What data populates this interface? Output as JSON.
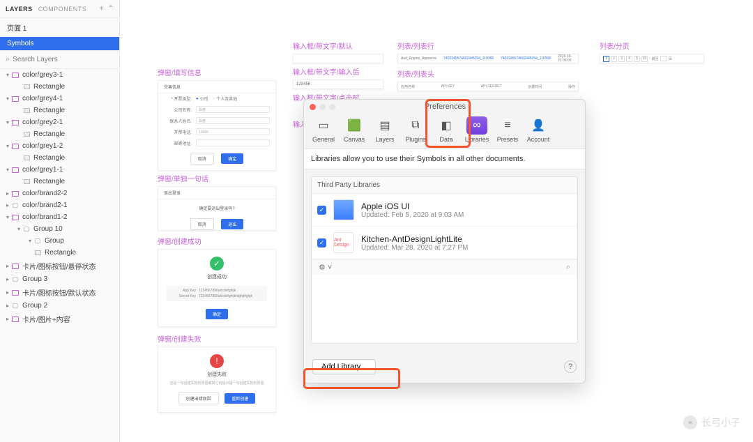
{
  "sidebar": {
    "tabs": {
      "layers": "LAYERS",
      "components": "COMPONENTS"
    },
    "page_label": "页面 1",
    "symbols_label": "Symbols",
    "search_placeholder": "Search Layers"
  },
  "layers": [
    {
      "depth": 1,
      "arrow": "▾",
      "icon": "artboard",
      "label": "color/grey3-1"
    },
    {
      "depth": 2,
      "arrow": "",
      "icon": "rect",
      "label": "Rectangle"
    },
    {
      "depth": 1,
      "arrow": "▾",
      "icon": "artboard",
      "label": "color/grey4-1"
    },
    {
      "depth": 2,
      "arrow": "",
      "icon": "rect",
      "label": "Rectangle"
    },
    {
      "depth": 1,
      "arrow": "▾",
      "icon": "artboard",
      "label": "color/grey2-1"
    },
    {
      "depth": 2,
      "arrow": "",
      "icon": "rect",
      "label": "Rectangle"
    },
    {
      "depth": 1,
      "arrow": "▾",
      "icon": "artboard",
      "label": "color/grey1-2"
    },
    {
      "depth": 2,
      "arrow": "",
      "icon": "rect",
      "label": "Rectangle"
    },
    {
      "depth": 1,
      "arrow": "▾",
      "icon": "artboard",
      "label": "color/grey1-1"
    },
    {
      "depth": 2,
      "arrow": "",
      "icon": "rect",
      "label": "Rectangle"
    },
    {
      "depth": 1,
      "arrow": "▸",
      "icon": "artboard",
      "label": "color/brand2-2"
    },
    {
      "depth": 1,
      "arrow": "▸",
      "icon": "folder",
      "label": "color/brand2-1"
    },
    {
      "depth": 1,
      "arrow": "▾",
      "icon": "artboard",
      "label": "color/brand1-2"
    },
    {
      "depth": 2,
      "arrow": "▾",
      "icon": "folder",
      "label": "Group 10"
    },
    {
      "depth": 3,
      "arrow": "▾",
      "icon": "folder",
      "label": "Group"
    },
    {
      "depth": 3,
      "arrow": "",
      "icon": "rect",
      "label": "Rectangle"
    },
    {
      "depth": 1,
      "arrow": "▸",
      "icon": "artboard",
      "label": "卡片/图标按钮/悬停状态"
    },
    {
      "depth": 1,
      "arrow": "▸",
      "icon": "folder",
      "label": "Group 3"
    },
    {
      "depth": 1,
      "arrow": "▸",
      "icon": "artboard",
      "label": "卡片/图标按钮/默认状态"
    },
    {
      "depth": 1,
      "arrow": "▸",
      "icon": "folder",
      "label": "Group 2"
    },
    {
      "depth": 1,
      "arrow": "▸",
      "icon": "artboard",
      "label": "卡片/图片+内容"
    }
  ],
  "artboards": {
    "fillInfo": {
      "title": "弹窗/填写信息",
      "header": "完善信息",
      "typeLabel": "* 开票类型:",
      "opt1": "公司",
      "opt2": "个人及其他",
      "rows": [
        {
          "lab": "公司名称:",
          "ph": "百度"
        },
        {
          "lab": "联系人姓名:",
          "ph": "百度"
        },
        {
          "lab": "开票电话:",
          "ph": "13666"
        },
        {
          "lab": "邮寄地址:",
          "ph": ""
        }
      ],
      "cancel": "取消",
      "confirm": "确定"
    },
    "singleSentence": {
      "title": "弹窗/单独一句话",
      "header": "退出登录",
      "text": "确定要退出登录吗?",
      "cancel": "取消",
      "confirm": "退出"
    },
    "createSuccess": {
      "title": "弹窗/创建成功",
      "text": "创建成功",
      "kv1l": "App Key",
      "kv1v": "1234567890abcdefghijk",
      "kv2l": "Secret Key",
      "kv2v": "1234567890abcdefghijkhfghjkfghjk",
      "btn": "确定"
    },
    "createFail": {
      "title": "弹窗/创建失败",
      "text": "创建失败",
      "desc": "这是一句创建失败的原因或其它的提示语一句创建失败的原因",
      "btn1": "创建出错原因",
      "btn2": "重新创建"
    },
    "inputDefault": {
      "title": "输入框/带文字/默认"
    },
    "inputAfter": {
      "title": "输入框/带文字/输入后",
      "value": "123456"
    },
    "inputClick": {
      "title": "输入框/带文字/点击时"
    },
    "inputPartial": {
      "title": "输入"
    },
    "listRow": {
      "title": "列表/列表行",
      "c1": "Arel_Engine_Appserve",
      "c2": "7402245574602445294_110368",
      "c3": "7402245574602445294_110368",
      "c4": "2019-10-22 00:00"
    },
    "listHead": {
      "title": "列表/列表头",
      "h1": "应用名称",
      "h2": "API KEY",
      "h3": "API SECRET",
      "h4": "创建时间",
      "h5": "操作"
    },
    "pagination": {
      "title": "列表/分页",
      "nums": [
        "1",
        "2",
        "3",
        "4",
        "5",
        "93"
      ],
      "next": "›",
      "jump": "跳至",
      "page": "页"
    }
  },
  "preferences": {
    "windowTitle": "Preferences",
    "tabs": [
      "General",
      "Canvas",
      "Layers",
      "Plugins",
      "Data",
      "Libraries",
      "Presets",
      "Account"
    ],
    "desc": "Libraries allow you to use their Symbols in all other documents.",
    "sectionTitle": "Third Party Libraries",
    "items": [
      {
        "name": "Apple iOS UI",
        "sub": "Updated: Feb 5, 2020 at 9:03 AM",
        "thumb": "ios"
      },
      {
        "name": "Kitchen-AntDesignLightLite",
        "sub": "Updated: Mar 28, 2020 at 7:27 PM",
        "thumb": "Ant Design"
      }
    ],
    "addLibrary": "Add Library...",
    "help": "?"
  },
  "watermark": "长弓小子"
}
